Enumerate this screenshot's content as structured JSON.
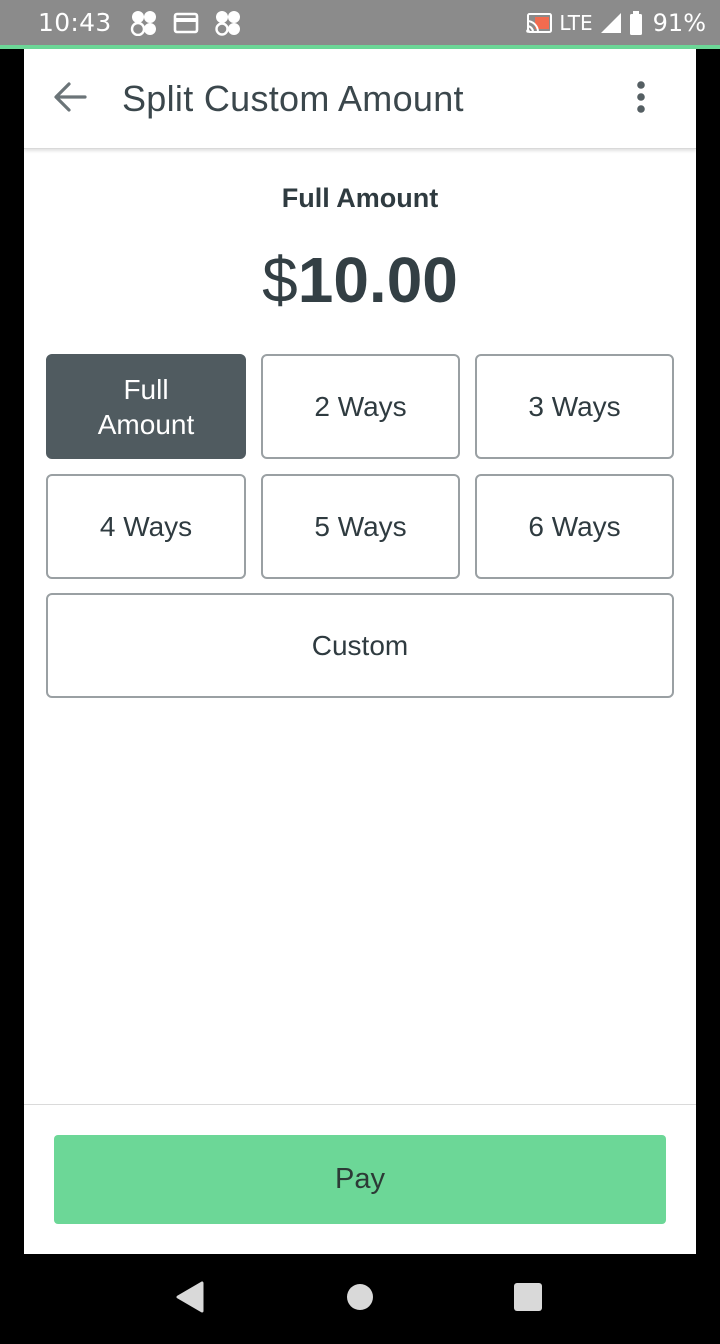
{
  "status_bar": {
    "time": "10:43",
    "network": "LTE",
    "battery": "91%",
    "icons": [
      "clover-icon",
      "card-icon",
      "clover-outline-icon",
      "cast-icon",
      "signal-icon",
      "battery-icon"
    ]
  },
  "header": {
    "title": "Split Custom Amount",
    "back_icon": "arrow-left-icon",
    "menu_icon": "more-vertical-icon"
  },
  "main": {
    "amount_label": "Full Amount",
    "currency_symbol": "$",
    "amount_value": "10.00",
    "options": [
      {
        "label": "Full\nAmount",
        "selected": true
      },
      {
        "label": "2 Ways",
        "selected": false
      },
      {
        "label": "3 Ways",
        "selected": false
      },
      {
        "label": "4 Ways",
        "selected": false
      },
      {
        "label": "5 Ways",
        "selected": false
      },
      {
        "label": "6 Ways",
        "selected": false
      },
      {
        "label": "Custom",
        "selected": false
      }
    ]
  },
  "footer": {
    "pay_label": "Pay"
  },
  "colors": {
    "accent": "#6cd797",
    "selected": "#505b60",
    "text": "#2f3b40"
  },
  "nav_bar": {
    "icons": [
      "back-triangle-icon",
      "home-circle-icon",
      "recents-square-icon"
    ]
  }
}
